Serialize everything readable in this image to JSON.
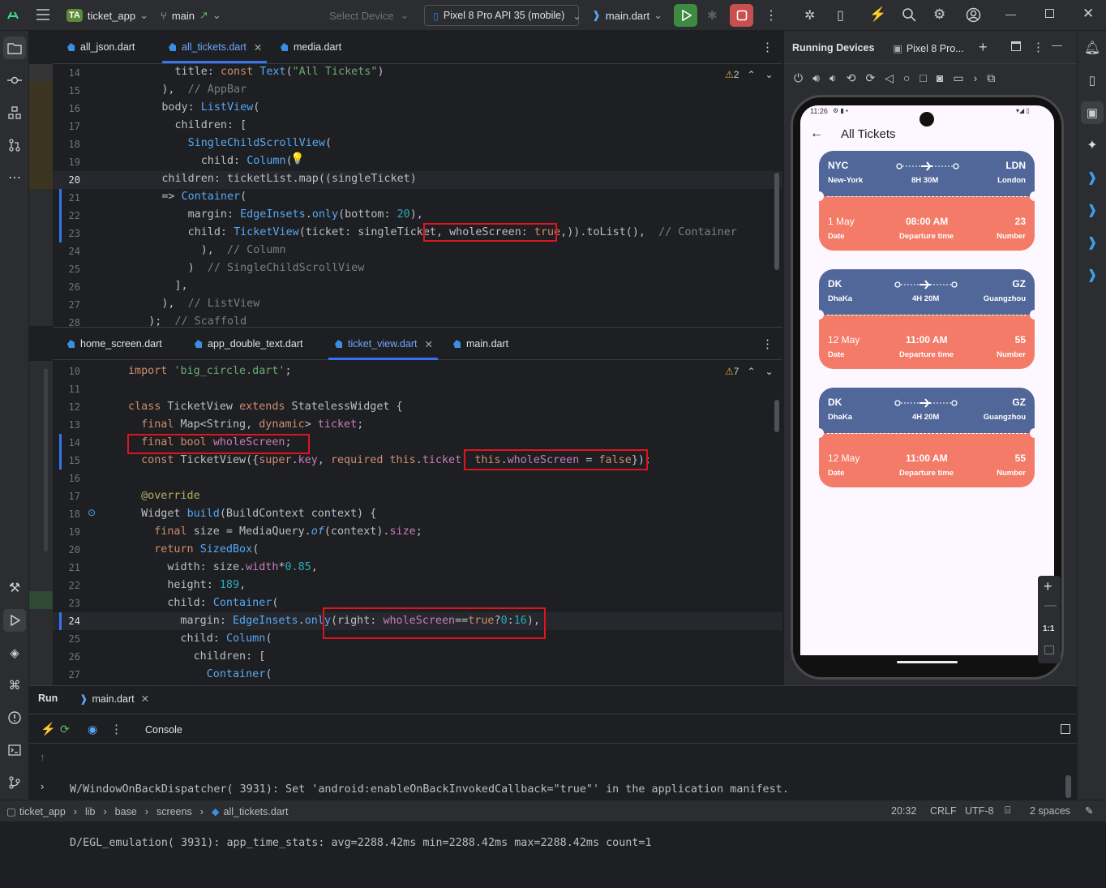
{
  "titlebar": {
    "project_badge": "TA",
    "project_name": "ticket_app",
    "branch": "main",
    "select_device": "Select Device",
    "device": "Pixel 8 Pro API 35 (mobile)",
    "run_config": "main.dart"
  },
  "editor_top": {
    "tabs": [
      {
        "label": "all_json.dart"
      },
      {
        "label": "all_tickets.dart"
      },
      {
        "label": "media.dart"
      }
    ],
    "warning_count": "2",
    "line_numbers": [
      "14",
      "15",
      "16",
      "17",
      "18",
      "19",
      "20",
      "21",
      "22",
      "23",
      "24",
      "25",
      "26",
      "27",
      "28"
    ]
  },
  "editor_bottom": {
    "tabs": [
      {
        "label": "home_screen.dart"
      },
      {
        "label": "app_double_text.dart"
      },
      {
        "label": "ticket_view.dart"
      },
      {
        "label": "main.dart"
      }
    ],
    "warning_count": "7",
    "line_numbers": [
      "10",
      "11",
      "12",
      "13",
      "14",
      "15",
      "16",
      "17",
      "18",
      "19",
      "20",
      "21",
      "22",
      "23",
      "24",
      "25",
      "26",
      "27"
    ]
  },
  "devices": {
    "title": "Running Devices",
    "device_tab": "Pixel 8 Pro...",
    "status_time": "11:26",
    "zoom_label": "1:1"
  },
  "app": {
    "title": "All Tickets",
    "tickets": [
      {
        "from_code": "NYC",
        "from_name": "New-York",
        "duration": "8H 30M",
        "to_code": "LDN",
        "to_name": "London",
        "date": "1 May",
        "date_label": "Date",
        "time": "08:00 AM",
        "time_label": "Departure time",
        "number": "23",
        "number_label": "Number"
      },
      {
        "from_code": "DK",
        "from_name": "DhaKa",
        "duration": "4H 20M",
        "to_code": "GZ",
        "to_name": "Guangzhou",
        "date": "12 May",
        "date_label": "Date",
        "time": "11:00 AM",
        "time_label": "Departure time",
        "number": "55",
        "number_label": "Number"
      },
      {
        "from_code": "DK",
        "from_name": "DhaKa",
        "duration": "4H 20M",
        "to_code": "GZ",
        "to_name": "Guangzhou",
        "date": "12 May",
        "date_label": "Date",
        "time": "11:00 AM",
        "time_label": "Departure time",
        "number": "55",
        "number_label": "Number"
      }
    ]
  },
  "run": {
    "label": "Run",
    "config_tab": "main.dart",
    "console_tab": "Console",
    "log": [
      "W/WindowOnBackDispatcher( 3931): Set 'android:enableOnBackInvokedCallback=\"true\"' in the application manifest.",
      "D/EGL_emulation( 3931): app_time_stats: avg=2288.42ms min=2288.42ms max=2288.42ms count=1"
    ]
  },
  "statusbar": {
    "breadcrumb": [
      "ticket_app",
      "lib",
      "base",
      "screens",
      "all_tickets.dart"
    ],
    "position": "20:32",
    "line_sep": "CRLF",
    "encoding": "UTF-8",
    "indent": "2 spaces"
  },
  "colors": {
    "ticket_top": "#526799",
    "ticket_bottom": "#f37b67",
    "accent": "#3574f0",
    "highlight": "#e0141e"
  }
}
